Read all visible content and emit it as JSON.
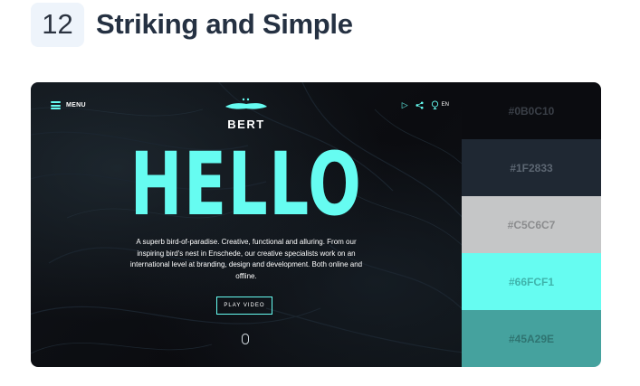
{
  "heading": {
    "number": "12",
    "title": "Striking and Simple"
  },
  "hero": {
    "menu_label": "MENU",
    "logo_name": "BERT",
    "language": "EN",
    "headline": "HELLO",
    "description": "A superb bird-of-paradise. Creative, functional and alluring. From our inspiring bird's nest in Enschede, our creative specialists work on an international level at branding, design and development. Both online and offline.",
    "cta_label": "PLAY VIDEO",
    "icons": [
      "menu-icon",
      "play-icon",
      "share-icon",
      "globe-icon",
      "scroll-mouse-icon"
    ]
  },
  "palette": [
    {
      "hex": "#0B0C10",
      "bg": "#0b0c10",
      "fg": "#3a3f47"
    },
    {
      "hex": "#1F2833",
      "bg": "#1f2833",
      "fg": "#5c6672"
    },
    {
      "hex": "#C5C6C7",
      "bg": "#c5c6c7",
      "fg": "#8b8c8e"
    },
    {
      "hex": "#66FCF1",
      "bg": "#66fcf1",
      "fg": "#3fb4ac"
    },
    {
      "hex": "#45A29E",
      "bg": "#45a29e",
      "fg": "#2f7471"
    }
  ],
  "colors": {
    "accent": "#66fcf1",
    "dark": "#0b0c10"
  }
}
